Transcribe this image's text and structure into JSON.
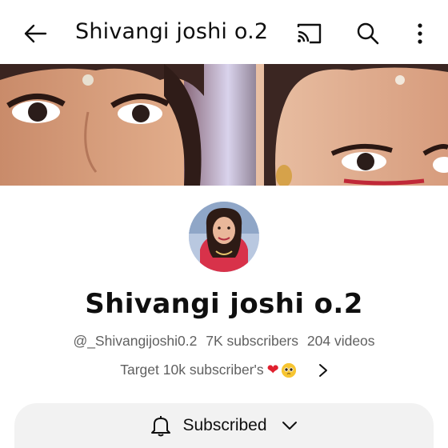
{
  "header": {
    "title": "Shivangi joshi o.2",
    "icons": [
      "back-arrow-icon",
      "cast-icon",
      "search-icon",
      "more-vert-icon"
    ]
  },
  "channel": {
    "name": "Shivangi joshi o.2",
    "handle": "@_Shivangijoshi0.2",
    "subscribers": "7K subscribers",
    "videos": "204 videos",
    "description": "Target 10k subscriber's",
    "description_emojis": [
      "red-heart",
      "pleading-face"
    ]
  },
  "subscribe_button": {
    "label": "Subscribed",
    "icons": [
      "bell-icon",
      "chevron-down-icon"
    ]
  },
  "colors": {
    "text_primary": "#0f0f0f",
    "text_secondary": "#606060",
    "button_bg": "#f2f2f2"
  }
}
